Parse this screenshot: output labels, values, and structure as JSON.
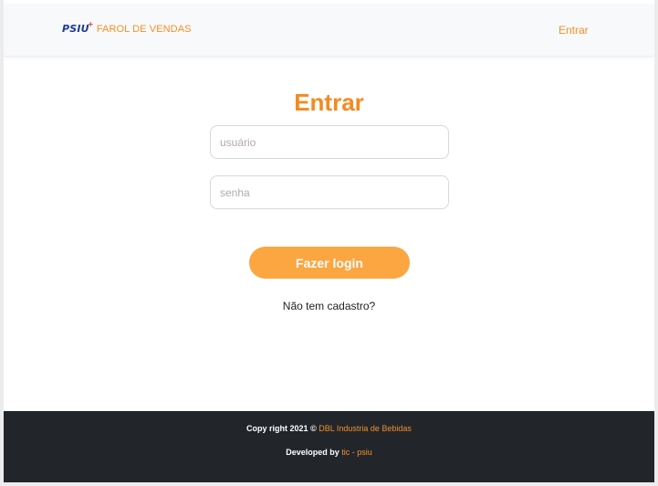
{
  "header": {
    "logo_text": "PSIU",
    "logo_mark": "+",
    "brand_text": "FAROL DE VENDAS",
    "nav_login": "Entrar"
  },
  "main": {
    "title": "Entrar",
    "username_placeholder": "usuário",
    "password_placeholder": "senha",
    "login_button": "Fazer login",
    "signup_link": "Não tem cadastro?"
  },
  "footer": {
    "copyright_prefix": "Copy right 2021 © ",
    "copyright_company": "DBL Industria de Bebidas",
    "developed_prefix": "Developed by ",
    "developed_company": "tic - psiu"
  },
  "colors": {
    "accent": "#f4902a",
    "button": "#fba641",
    "logo_blue": "#1b3a9a",
    "footer_bg": "#22262b"
  }
}
